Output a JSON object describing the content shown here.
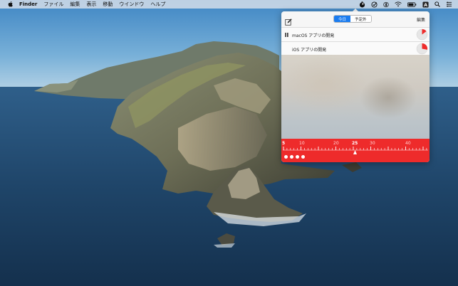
{
  "menubar": {
    "app_name": "Finder",
    "items": [
      "ファイル",
      "編集",
      "表示",
      "移動",
      "ウインドウ",
      "ヘルプ"
    ],
    "status_icons": [
      "timer-app-icon",
      "checkmark-circle-icon",
      "bluetooth-icon",
      "wifi-icon",
      "battery-icon",
      "input-source-icon",
      "spotlight-icon",
      "control-center-icon"
    ],
    "input_source_letter": "A"
  },
  "popover": {
    "segments": [
      {
        "label": "今日",
        "active": true
      },
      {
        "label": "予定外",
        "active": false
      }
    ],
    "edit_label": "編集",
    "tasks": [
      {
        "label": "macOS アプリの開発",
        "playing_icon": "pause-icon",
        "progress": 0.15,
        "color": "#ee2b2b"
      },
      {
        "label": "iOS アプリの開発",
        "playing_icon": "",
        "progress": 0.28,
        "color": "#ee2b2b"
      }
    ],
    "timeline": {
      "labels": [
        "5",
        "10",
        "20",
        "25",
        "30",
        "40"
      ],
      "current": "25",
      "dot_count": 4,
      "color": "#ee2b2b"
    }
  }
}
